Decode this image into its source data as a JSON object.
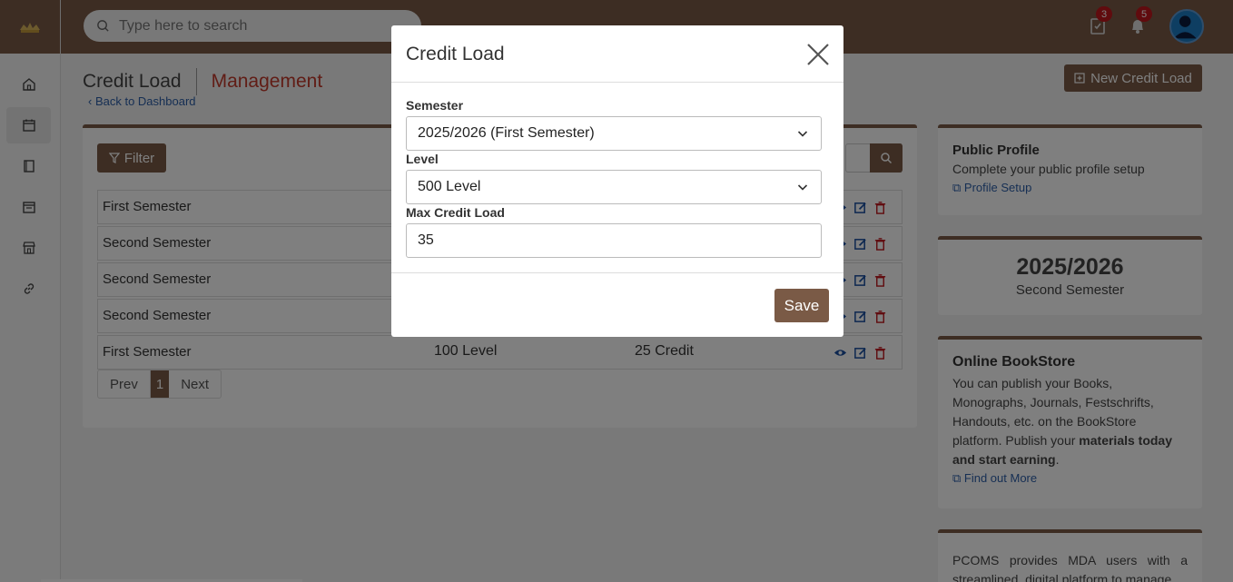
{
  "search": {
    "placeholder": "Type here to search"
  },
  "topbar": {
    "tasks_count": "3",
    "notifications_count": "5"
  },
  "colors": {
    "brand": "#7a5a46",
    "accent_red": "#c23a2c",
    "link": "#2d5fa8"
  },
  "header": {
    "title": "Credit Load",
    "subtitle": "Management",
    "back_link": "Back to Dashboard",
    "new_button": "New Credit Load"
  },
  "toolbar": {
    "filter_label": "Filter"
  },
  "table": {
    "rows": [
      {
        "semester": "First Semester",
        "level": "",
        "credit": ""
      },
      {
        "semester": "Second Semester",
        "level": "",
        "credit": ""
      },
      {
        "semester": "Second Semester",
        "level": "",
        "credit": ""
      },
      {
        "semester": "Second Semester",
        "level": "",
        "credit": ""
      },
      {
        "semester": "First Semester",
        "level": "100 Level",
        "credit": "25 Credit"
      }
    ]
  },
  "pager": {
    "prev": "Prev",
    "current": "1",
    "next": "Next"
  },
  "right": {
    "profile": {
      "title": "Public Profile",
      "text": "Complete your public profile setup",
      "link": "Profile Setup"
    },
    "session": {
      "year": "2025/2026",
      "semester": "Second Semester"
    },
    "bookstore": {
      "title": "Online BookStore",
      "text": "You can publish your Books, Monographs, Journals, Festschrifts, Handouts, etc. on the BookStore platform. Publish your",
      "bold": "materials today and start earning",
      "end": ".",
      "link": "Find out More"
    },
    "pcoms": {
      "text": "PCOMS provides MDA users with a streamlined, digital platform to manage"
    }
  },
  "modal": {
    "title": "Credit Load",
    "semester_label": "Semester",
    "semester_value": "2025/2026 (First Semester)",
    "level_label": "Level",
    "level_value": "500 Level",
    "max_label": "Max Credit Load",
    "max_value": "35",
    "save_label": "Save"
  }
}
